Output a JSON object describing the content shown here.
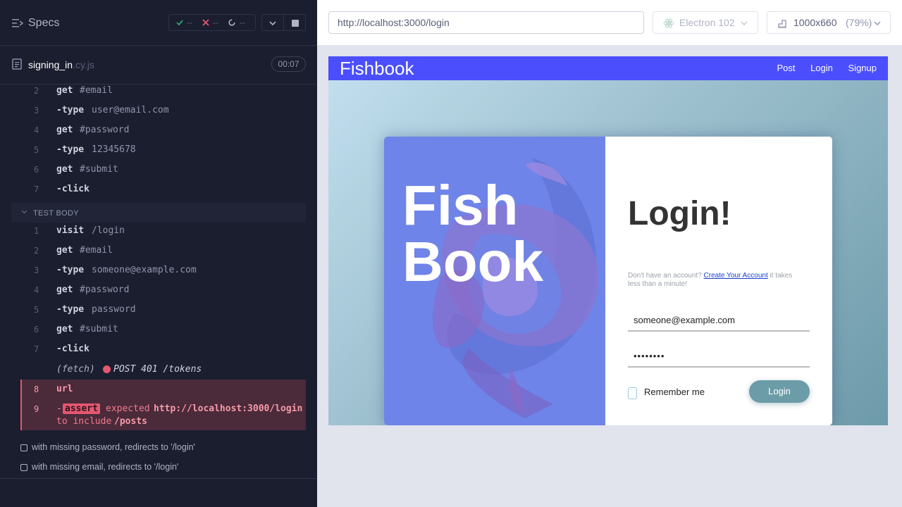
{
  "runner": {
    "specs_label": "Specs",
    "stats": {
      "passed": "--",
      "failed": "--",
      "pending": "--"
    },
    "file": {
      "name": "signing_in",
      "ext": ".cy.js",
      "timer": "00:07"
    },
    "before_commands": [
      {
        "num": "2",
        "name": "get",
        "arg": "#email"
      },
      {
        "num": "3",
        "name": "-type",
        "arg": "user@email.com"
      },
      {
        "num": "4",
        "name": "get",
        "arg": "#password"
      },
      {
        "num": "5",
        "name": "-type",
        "arg": "12345678"
      },
      {
        "num": "6",
        "name": "get",
        "arg": "#submit"
      },
      {
        "num": "7",
        "name": "-click",
        "arg": ""
      }
    ],
    "test_body_label": "TEST BODY",
    "test_body_commands": [
      {
        "num": "1",
        "name": "visit",
        "arg": "/login"
      },
      {
        "num": "2",
        "name": "get",
        "arg": "#email"
      },
      {
        "num": "3",
        "name": "-type",
        "arg": "someone@example.com"
      },
      {
        "num": "4",
        "name": "get",
        "arg": "#password"
      },
      {
        "num": "5",
        "name": "-type",
        "arg": "password"
      },
      {
        "num": "6",
        "name": "get",
        "arg": "#submit"
      },
      {
        "num": "7",
        "name": "-click",
        "arg": ""
      }
    ],
    "fetch": {
      "label": "(fetch)",
      "detail": "POST 401 /tokens"
    },
    "failed": {
      "url_num": "8",
      "url_name": "url",
      "assert_num": "9",
      "assert_dash": "-",
      "assert_badge": "assert",
      "expected": "expected",
      "actual": "http://localhost:3000/login",
      "to_include": "to include",
      "expected_value": "/posts"
    },
    "other_tests": [
      "with missing password, redirects to '/login'",
      "with missing email, redirects to '/login'"
    ]
  },
  "browser_bar": {
    "url": "http://localhost:3000/login",
    "browser": "Electron 102",
    "viewport": "1000x660",
    "zoom": "(79%)"
  },
  "app": {
    "brand": "Fishbook",
    "nav": [
      "Post",
      "Login",
      "Signup"
    ],
    "hero_line1": "Fish",
    "hero_line2": "Book",
    "title": "Login!",
    "note_prefix": "Don't have an account? ",
    "note_link": "Create Your Account",
    "note_suffix": " it takes less than a minute!",
    "email_value": "someone@example.com",
    "password_value": "••••••••",
    "remember_label": "Remember me",
    "login_button": "Login"
  },
  "colors": {
    "pass": "#1fa971",
    "fail": "#e45770",
    "nav": "#4b4efc",
    "card_left": "#6f84e9",
    "login_button": "#6b9ca8"
  }
}
